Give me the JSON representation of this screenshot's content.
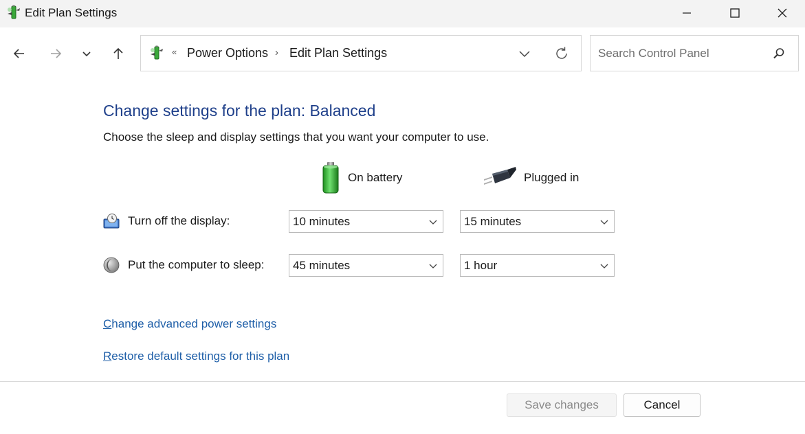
{
  "window": {
    "title": "Edit Plan Settings",
    "icon": "power-options-icon"
  },
  "navigation": {
    "back_icon": "arrow-left-icon",
    "forward_icon": "arrow-right-icon",
    "recent_icon": "chevron-down-icon",
    "up_icon": "arrow-up-icon"
  },
  "address_bar": {
    "overflow_chevron": "«",
    "breadcrumbs": [
      "Power Options",
      "Edit Plan Settings"
    ],
    "separator": "›"
  },
  "search": {
    "placeholder": "Search Control Panel",
    "value": ""
  },
  "content": {
    "title": "Change settings for the plan: Balanced",
    "description": "Choose the sleep and display settings that you want your computer to use.",
    "columns": [
      {
        "label": "On battery",
        "icon": "battery-icon"
      },
      {
        "label": "Plugged in",
        "icon": "power-plug-icon"
      }
    ],
    "settings": [
      {
        "label": "Turn off the display:",
        "icon": "display-clock-icon",
        "on_battery": "10 minutes",
        "plugged_in": "15 minutes"
      },
      {
        "label": "Put the computer to sleep:",
        "icon": "moon-sleep-icon",
        "on_battery": "45 minutes",
        "plugged_in": "1 hour"
      }
    ],
    "links": {
      "advanced_first": "C",
      "advanced_rest": "hange advanced power settings",
      "restore_first": "R",
      "restore_rest": "estore default settings for this plan"
    }
  },
  "footer": {
    "save_label": "Save changes",
    "cancel_label": "Cancel",
    "save_enabled": false
  },
  "colors": {
    "title_blue": "#1e3f8a",
    "link_blue": "#1f5fa8",
    "titlebar_bg": "#f3f3f3"
  }
}
